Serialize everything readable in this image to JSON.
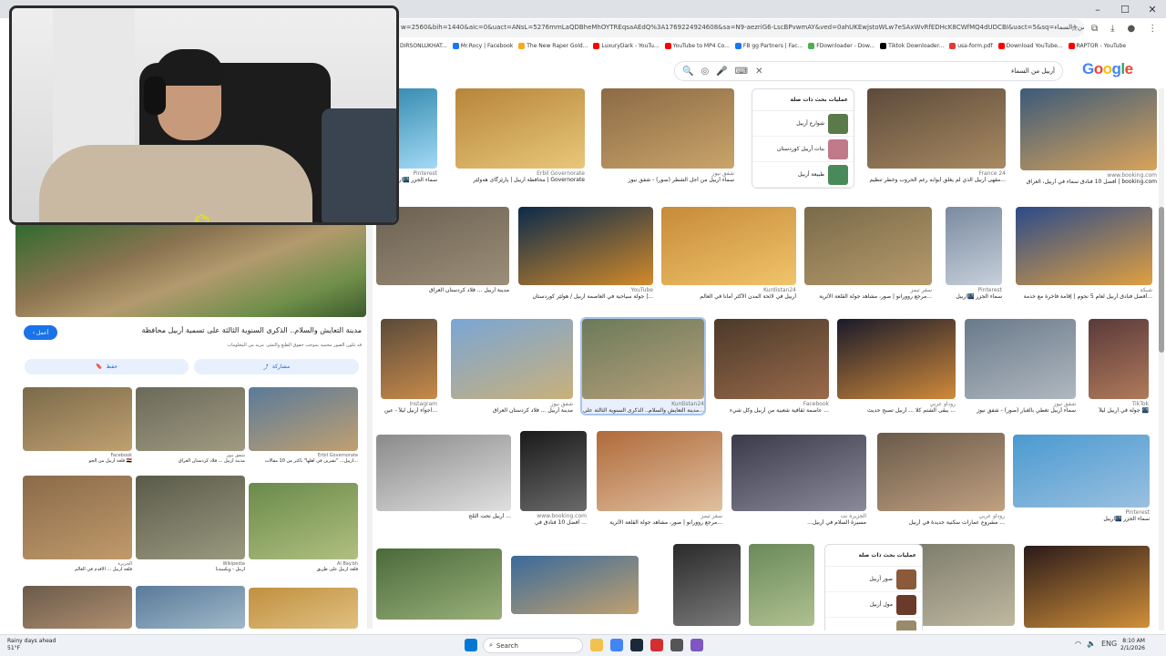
{
  "browser": {
    "url": "w=2560&bih=1440&aic=0&uact=ANsL=5276mmLaQDBheMhOYTREqsaAEdQ%3A1769224924608&sa=N9-aezriG6-LscBPvwmAY&ved=0ahUKEwjstoWLw7eSAxWvRfEDHcK8CWfMQ4dUDCBI&uact=5&sq=أربيل+من+السماء",
    "window_controls": {
      "minimize": "–",
      "maximize": "☐",
      "close": "✕"
    },
    "bookmarks": [
      {
        "label": "DIRSONLUKHAT...",
        "color": "#e53935"
      },
      {
        "label": "Mr.Rocy | Facebook",
        "color": "#1877f2"
      },
      {
        "label": "The New Raper Gold...",
        "color": "#f9a825"
      },
      {
        "label": "LuxuryDark - YouTu...",
        "color": "#ff0000"
      },
      {
        "label": "YouTube to MP4 Co...",
        "color": "#ff0000"
      },
      {
        "label": "FB gg Partners | Fac...",
        "color": "#1877f2"
      },
      {
        "label": "FDownloader - Dow...",
        "color": "#4caf50"
      },
      {
        "label": "Tiktok Downloader...",
        "color": "#000000"
      },
      {
        "label": "usa-form.pdf",
        "color": "#e53935"
      },
      {
        "label": "Download YouTube...",
        "color": "#ff0000"
      },
      {
        "label": "RAPTOR - YouTube",
        "color": "#ff0000"
      }
    ]
  },
  "google": {
    "logo": "Google",
    "query": "أربيل من السماء",
    "icons": {
      "search": "🔍",
      "lens": "◎",
      "mic": "🎤",
      "keyboard": "⌨",
      "clear": "✕"
    }
  },
  "results": [
    {
      "src": "Pinterest",
      "title": "سماء الجزر 🌃اربيل",
      "colors": [
        "#2e86ab",
        "#a3d9f5"
      ]
    },
    {
      "src": "Erbil Governorate",
      "title": "محافظة أربيل | پارێزگای هەولێر | Governorate",
      "colors": [
        "#b7853a",
        "#e8c77a"
      ]
    },
    {
      "src": "شفق نيوز",
      "title": "سماء أربيل من أجل الشطر (صور) - شفق نيوز",
      "colors": [
        "#8c6a45",
        "#c9a46a"
      ]
    },
    {
      "src": "France 24",
      "title": "مقهى أربيل الذي لم يغلق أبوابه رغم الحروب وخطر تنظيم...",
      "colors": [
        "#5c4a3a",
        "#a88a62"
      ]
    },
    {
      "src": "www.booking.com",
      "title": "أفضل 10 فنادق سماء في أربيل، العراق | booking.com",
      "colors": [
        "#3b5a7a",
        "#d9a35a"
      ]
    },
    {
      "src": "",
      "title": "مدينة أربيل ... فلاد كردستان العراق",
      "colors": [
        "#6b6152",
        "#9c8e78"
      ]
    },
    {
      "src": "YouTube",
      "title": "جولة سياحية في العاصمة أربيل / هولێر كوردستان |...",
      "colors": [
        "#0b2a4a",
        "#d28a2a"
      ]
    },
    {
      "src": "Kurdistan24",
      "title": "أربيل في لائحة المدن الأكثر أماناً في العالم",
      "colors": [
        "#c78a3a",
        "#f0c46a"
      ]
    },
    {
      "src": "سفر تيمز",
      "title": "مرجع روورانو | صور، مشاهد جولة القلعة الأثرية...",
      "colors": [
        "#7a6a4a",
        "#b59a6a"
      ]
    },
    {
      "src": "Pinterest",
      "title": "سماء الجزر 🌃اربيل",
      "colors": [
        "#7a8aa0",
        "#c7d0da"
      ]
    },
    {
      "src": "شبكة",
      "title": "أفضل فنادق أربيل لعام 5 نجوم | إقامة فاخرة مع خدمة...",
      "colors": [
        "#2b4a8a",
        "#e0a040"
      ]
    },
    {
      "src": "Instagram",
      "title": "أجواء أربيل ليلاً - عين...",
      "colors": [
        "#5a4a3a",
        "#c78a4a"
      ]
    },
    {
      "src": "شفق نيوز",
      "title": "مدينة أربيل ... فلاد كردستان العراق",
      "colors": [
        "#7aa6d6",
        "#c9b07a"
      ]
    },
    {
      "src": "Kurdistan24",
      "title": "مدينة التعايش والسلام.. الذكرى السنوية الثالثة على...",
      "colors": [
        "#6b7a5a",
        "#b8a07a"
      ]
    },
    {
      "src": "Facebook",
      "title": "عاصمة ثقافية شعبية من أربيل وكل شيء ...",
      "colors": [
        "#4a3a2a",
        "#9a6a4a"
      ]
    },
    {
      "src": "روداو عربي",
      "title": "يبقى الشتم كلا ... أربيل تصبح حديث ...",
      "colors": [
        "#1a1a2a",
        "#d08a3a"
      ]
    },
    {
      "src": "شفق نيوز",
      "title": "سماء أربيل تغطي بالغبار (صور) - شفق نيوز",
      "colors": [
        "#6a7a8a",
        "#b0b8c0"
      ]
    },
    {
      "src": "TikTok",
      "title": "جولة في أربيل ليلاً 🌃",
      "colors": [
        "#5a3a3a",
        "#b07a5a"
      ]
    },
    {
      "src": "",
      "title": "أربيل تحت الثلج ...",
      "colors": [
        "#8a8a8a",
        "#e0e0e0"
      ]
    },
    {
      "src": "www.booking.com",
      "title": "أفضل 10 فنادق في ...",
      "colors": [
        "#1a1a1a",
        "#6a6a6a"
      ]
    },
    {
      "src": "سفر تيمز",
      "title": "مرجع روورانو | صور، مشاهد جولة القلعة الأثرية...",
      "colors": [
        "#b06a3a",
        "#e0c0a0"
      ]
    },
    {
      "src": "الجزيرة نت",
      "title": "...مسيرة السلام في أربيل",
      "colors": [
        "#3a3a4a",
        "#8a8a9a"
      ]
    },
    {
      "src": "روداو عربي",
      "title": "مشروع عمارات سكنية جديدة في أربيل ...",
      "colors": [
        "#6a5a4a",
        "#c0a080"
      ]
    },
    {
      "src": "Pinterest",
      "title": "سماء الجزر 🌃اربيل",
      "colors": [
        "#4a9ad0",
        "#9ac0e0"
      ]
    },
    {
      "src": "",
      "title": "",
      "colors": [
        "#4a6a3a",
        "#9ab07a"
      ]
    },
    {
      "src": "",
      "title": "",
      "colors": [
        "#3a6a9a",
        "#c0a070"
      ]
    },
    {
      "src": "",
      "title": "",
      "colors": [
        "#2a2a2a",
        "#7a7a7a"
      ]
    },
    {
      "src": "",
      "title": "",
      "colors": [
        "#6a8a5a",
        "#b0c090"
      ]
    },
    {
      "src": "",
      "title": "",
      "colors": [
        "#7a7a6a",
        "#c0b8a0"
      ]
    },
    {
      "src": "",
      "title": "",
      "colors": [
        "#2a1a1a",
        "#d0903a"
      ]
    }
  ],
  "related1": {
    "header": "عمليات بحث ذات صلة",
    "items": [
      {
        "label": "شوارع أربيل",
        "color": "#5a7a4a"
      },
      {
        "label": "بنات أربيل كوردستان",
        "color": "#c07a8a"
      },
      {
        "label": "طبيعة أربيل",
        "color": "#4a8a5a"
      }
    ]
  },
  "related2": {
    "header": "عمليات بحث ذات صلة",
    "items": [
      {
        "label": "صور أربيل",
        "color": "#8a5a3a"
      },
      {
        "label": "مول أربيل",
        "color": "#6a3a2a"
      },
      {
        "label": "",
        "color": "#9a8a6a"
      }
    ]
  },
  "panel": {
    "title": "مدينة التعايش والسلام.. الذكرى السنوية الثالثة على تسمية أربيل محافظة",
    "subtitle": "قد تكون الصور محمية بموجب حقوق الطبع والنشر. مزيد من المعلومات",
    "visit": "‹ أعمل",
    "share": "مشاركة",
    "save": "حفظ",
    "similar": [
      {
        "src": "Facebook",
        "title": "قلعة أربيل من الجو 🇮🇶",
        "colors": [
          "#7a6a4a",
          "#c0a070"
        ]
      },
      {
        "src": "شفق نيوز",
        "title": "مدينة أربيل ... فلاد كردستان العراق",
        "colors": [
          "#6a6a5a",
          "#a09a80"
        ]
      },
      {
        "src": "Erbil Governorate",
        "title": "أربيل... \"تشرين في أهلها\" بأكثر من 10 مقالات...",
        "colors": [
          "#5a7a9a",
          "#c0a070"
        ]
      },
      {
        "src": "الجزيرة",
        "title": "قلعة أربيل ... الأقدم في العالم",
        "colors": [
          "#8a6a4a",
          "#c09a6a"
        ]
      },
      {
        "src": "Wikipedia",
        "title": "أربيل - ويكيبيديا",
        "colors": [
          "#5a5a4a",
          "#9a9a80"
        ]
      },
      {
        "src": "Al Bay.bh",
        "title": "قلعة أربيل على طريق",
        "colors": [
          "#6a8a4a",
          "#b0c080"
        ]
      },
      {
        "src": "",
        "title": "",
        "colors": [
          "#6a5a4a",
          "#b09070"
        ]
      },
      {
        "src": "",
        "title": "",
        "colors": [
          "#5a7a9a",
          "#a0b8c8"
        ]
      },
      {
        "src": "",
        "title": "",
        "colors": [
          "#c09040",
          "#e0c080"
        ]
      }
    ]
  },
  "taskbar": {
    "weather_line1": "Rainy days ahead",
    "weather_line2": "51°F",
    "search": "Search",
    "time": "8:10 AM",
    "date": "2/1/2026",
    "tray": "ENG",
    "apps": [
      {
        "name": "file-explorer",
        "color": "#f2c14e"
      },
      {
        "name": "chrome",
        "color": "#4285f4"
      },
      {
        "name": "steam",
        "color": "#1b2838"
      },
      {
        "name": "app",
        "color": "#d32f2f"
      },
      {
        "name": "app2",
        "color": "#555555"
      },
      {
        "name": "app3",
        "color": "#7e57c2"
      }
    ]
  }
}
